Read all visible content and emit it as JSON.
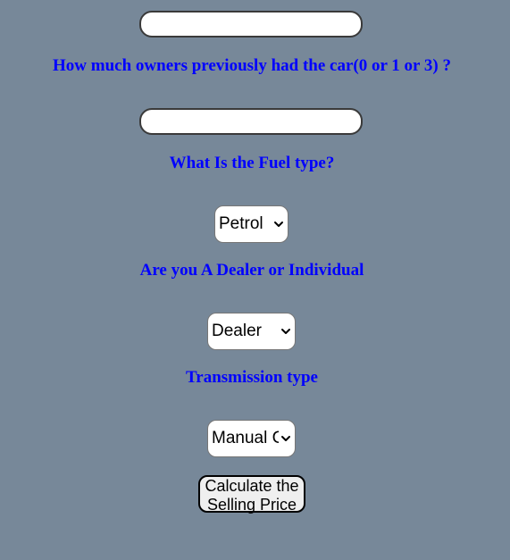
{
  "form": {
    "input_1": {
      "value": ""
    },
    "owners_question": "How much owners previously had the car(0 or 1 or 3) ?",
    "owners_input": {
      "value": ""
    },
    "fuel_question": "What Is the Fuel type?",
    "fuel_select": {
      "selected": "Petrol"
    },
    "seller_question": "Are you A Dealer or Individual",
    "seller_select": {
      "selected": "Dealer"
    },
    "transmission_question": "Transmission type",
    "transmission_select": {
      "selected": "Manual Car"
    },
    "submit_label": "Calculate the Selling Price"
  }
}
